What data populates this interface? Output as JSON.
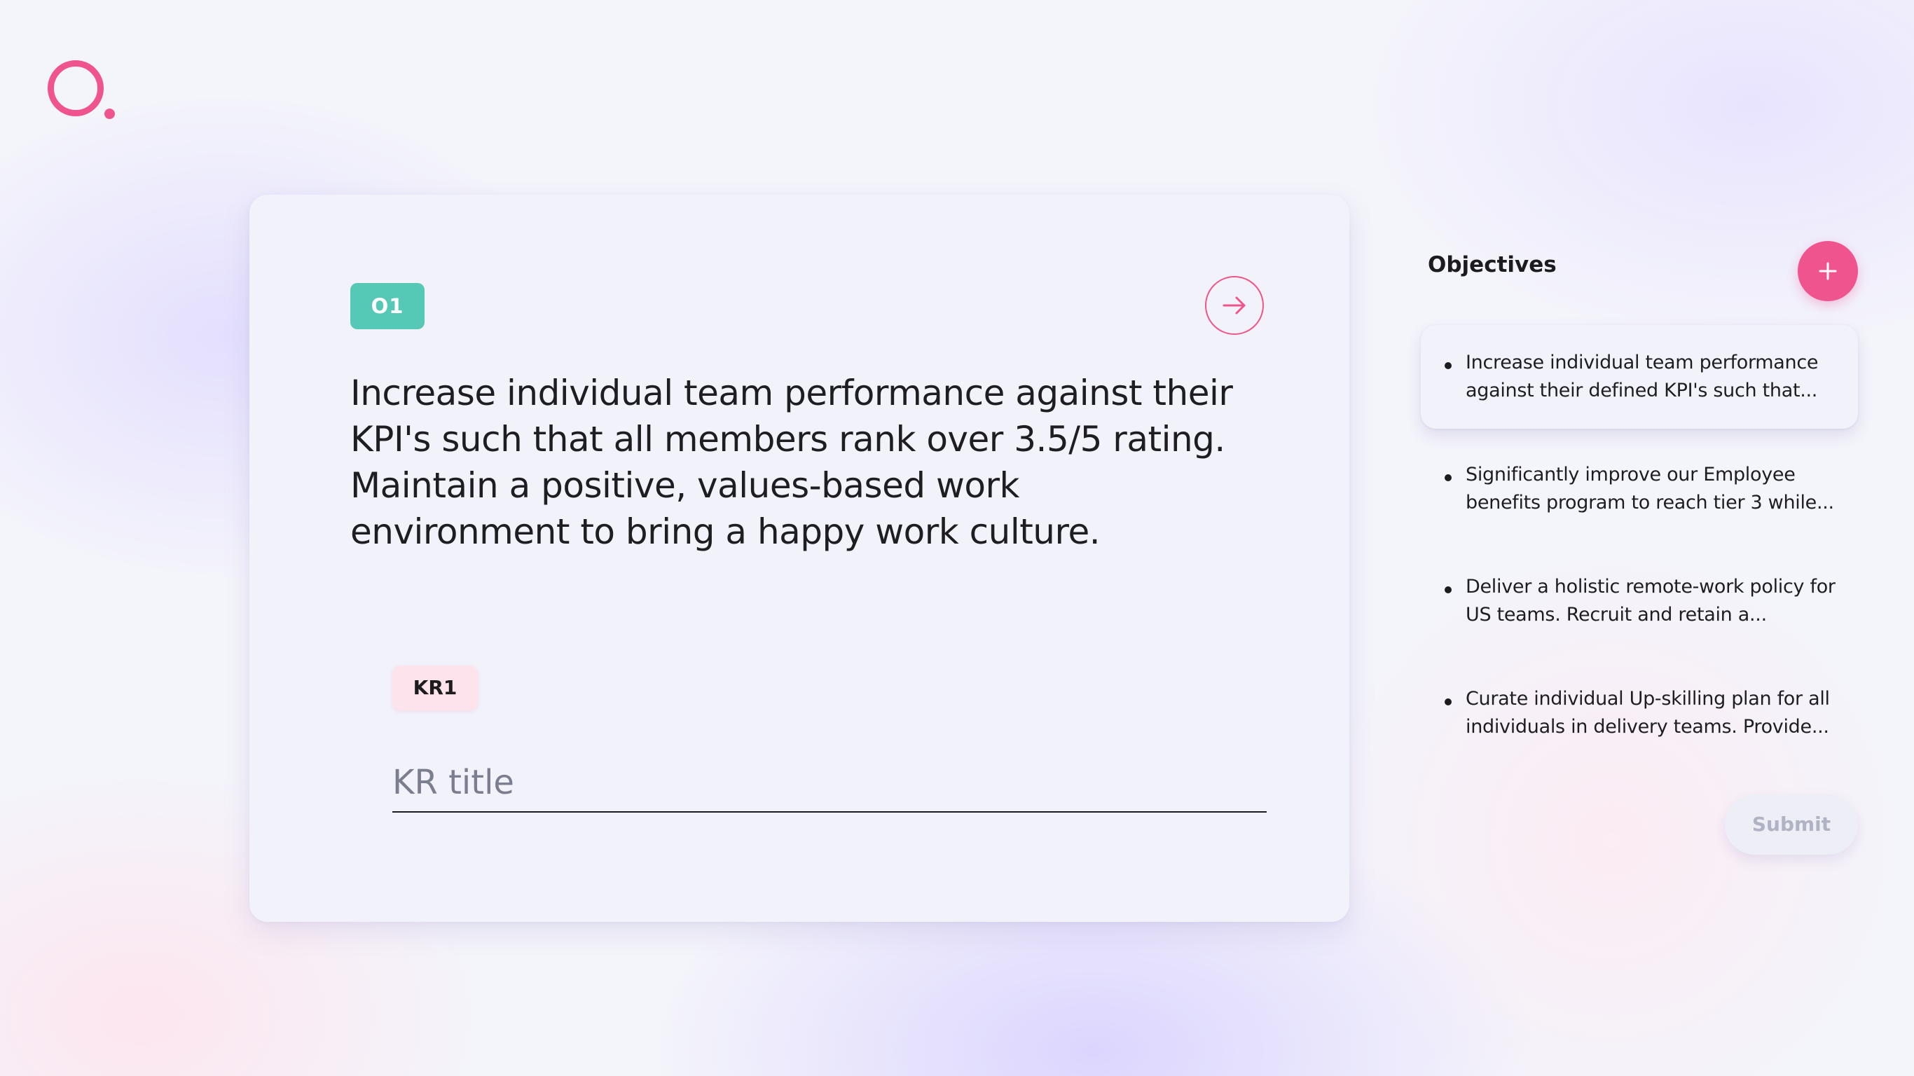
{
  "app": {
    "logo_icon": "brand-o-logo",
    "accent_color": "#f0548e",
    "teal_color": "#56c8b6"
  },
  "card": {
    "objective_badge": "O1",
    "objective_text": "Increase individual team performance against their\nKPI's such that all members rank over 3.5/5 rating.\nMaintain a positive, values-based work\nenvironment to bring a happy work  culture.",
    "next_icon": "arrow-right-icon",
    "kr_badge": "KR1",
    "kr_title_placeholder": "KR title",
    "kr_title_value": ""
  },
  "panel": {
    "title": "Objectives",
    "add_icon": "plus-icon",
    "items": [
      {
        "label": "Increase individual team performance\nagainst their defined KPI's such that...",
        "active": true
      },
      {
        "label": "Significantly improve our Employee\nbenefits program to reach tier 3 while...",
        "active": false
      },
      {
        "label": "Deliver a holistic remote-work policy  for\nUS teams. Recruit and retain a...",
        "active": false
      },
      {
        "label": "Curate individual Up-skilling plan for all\nindividuals in delivery teams. Provide...",
        "active": false
      }
    ],
    "submit_label": "Submit",
    "submit_enabled": false
  }
}
